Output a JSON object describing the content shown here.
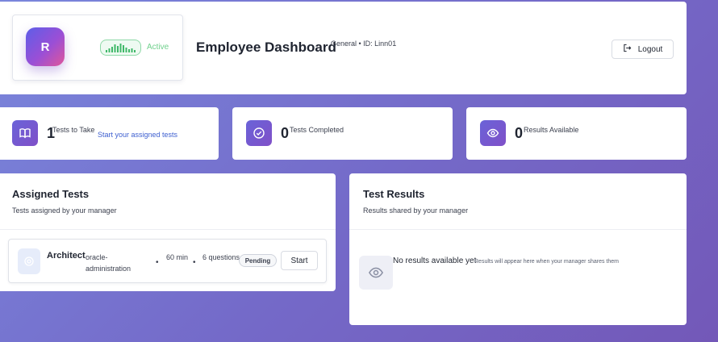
{
  "header": {
    "avatar_initial": "R",
    "status": "Active",
    "title": "Employee Dashboard",
    "department_info": "General • ID: Linn01",
    "logout_label": "Logout"
  },
  "stats": [
    {
      "value": "1",
      "label": "Tests to Take",
      "link": "Start your assigned tests"
    },
    {
      "value": "0",
      "label": "Tests Completed"
    },
    {
      "value": "0",
      "label": "Results Available"
    }
  ],
  "assigned": {
    "title": "Assigned Tests",
    "subtitle": "Tests assigned by your manager",
    "tests": [
      {
        "name": "Architect",
        "category": "oracle-administration",
        "duration": "60 min",
        "questions": "6 questions",
        "status": "Pending",
        "action": "Start"
      }
    ]
  },
  "results": {
    "title": "Test Results",
    "subtitle": "Results shared by your manager",
    "empty_title": "No results available yet",
    "empty_subtitle": "Results will appear here when your manager shares them"
  },
  "colors": {
    "accent": "#6a5cd0",
    "active_green": "#6fd08c",
    "link_blue": "#3d5fd0"
  }
}
